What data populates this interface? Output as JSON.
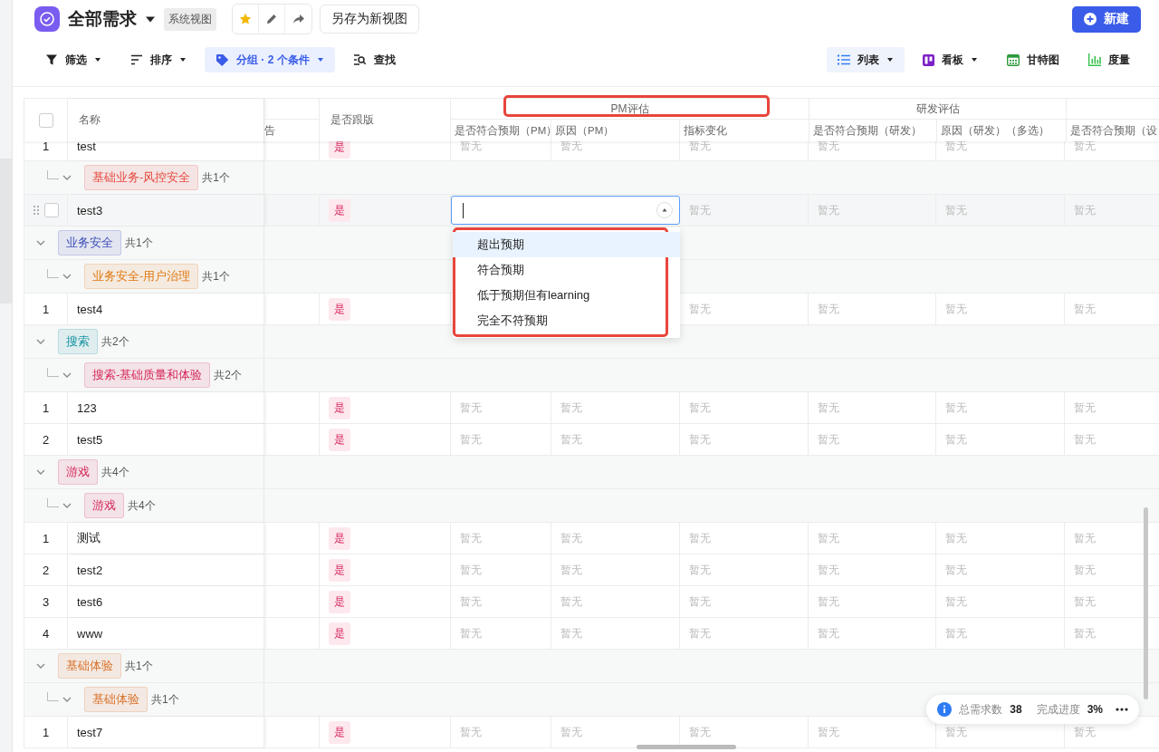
{
  "header": {
    "title": "全部需求",
    "view_badge": "系统视图",
    "favorite": true,
    "save_as_button": "另存为新视图",
    "new_button": "新建"
  },
  "toolbar": {
    "tools": [
      {
        "kind": "filter",
        "label": "筛选",
        "dropdown": true,
        "active": false
      },
      {
        "kind": "sort",
        "label": "排序",
        "dropdown": true,
        "active": false
      },
      {
        "kind": "group",
        "label": "分组 · 2 个条件",
        "dropdown": true,
        "active": true
      },
      {
        "kind": "find",
        "label": "查找",
        "dropdown": false,
        "active": false
      }
    ],
    "views": [
      {
        "kind": "list",
        "label": "列表",
        "dropdown": true,
        "selected": true
      },
      {
        "kind": "board",
        "label": "看板",
        "dropdown": true,
        "selected": false
      },
      {
        "kind": "gantt",
        "label": "甘特图",
        "dropdown": false,
        "selected": false
      },
      {
        "kind": "metrics",
        "label": "度量",
        "dropdown": false,
        "selected": false
      }
    ]
  },
  "table": {
    "select_all": {
      "checked": false
    },
    "columns": [
      {
        "label": "名称"
      },
      {
        "label": "告"
      },
      {
        "label": "是否跟版"
      }
    ],
    "column_groups": [
      {
        "label": "PM评估",
        "outlined": true,
        "columns": [
          "是否符合预期（PM）",
          "原因（PM）",
          "指标变化"
        ]
      },
      {
        "label": "研发评估",
        "columns": [
          "是否符合预期（研发）",
          "原因（研发）（多选）"
        ]
      },
      {
        "columns": [
          "是否符合预期（设"
        ]
      }
    ],
    "body": [
      {
        "kind": "row",
        "index": "1",
        "name": "test",
        "follow": "是",
        "hovered": false,
        "pm_expected": "暂无",
        "pm_reason": "暂无",
        "metric_change": "暂无",
        "dev_expected": "暂无",
        "dev_reason": "暂无",
        "design_expected": "暂无"
      },
      {
        "kind": "subgroup",
        "tag": "基础业务-风控安全",
        "color": "#e5483f",
        "count": "共1个",
        "expanded": true,
        "rows": [
          {
            "kind": "row",
            "name": "test3",
            "follow": "是",
            "hovered": true,
            "checked": false,
            "editor": {
              "outlined": true,
              "options": [
                {
                  "label": "超出预期",
                  "selected": true
                },
                {
                  "label": "符合预期",
                  "selected": false
                },
                {
                  "label": "低于预期但有learning",
                  "selected": false
                },
                {
                  "label": "完全不符预期",
                  "selected": false
                }
              ]
            },
            "metric_change": "暂无",
            "dev_expected": "暂无",
            "dev_reason": "暂无",
            "design_expected": "暂无"
          }
        ]
      },
      {
        "kind": "group",
        "tag": "业务安全",
        "color": "#3d4db7",
        "count": "共1个",
        "expanded": true,
        "children": [
          {
            "kind": "subgroup",
            "tag": "业务安全-用户治理",
            "color": "#e0780f",
            "count": "共1个",
            "expanded": true,
            "rows": [
              {
                "kind": "row",
                "index": "1",
                "name": "test4",
                "follow": "是",
                "hovered": false,
                "metric_change": "暂无",
                "dev_expected": "暂无",
                "dev_reason": "暂无",
                "design_expected": "暂无"
              }
            ]
          }
        ]
      },
      {
        "kind": "group",
        "tag": "搜索",
        "color": "#1592a3",
        "count": "共2个",
        "expanded": true,
        "children": [
          {
            "kind": "subgroup",
            "tag": "搜索-基础质量和体验",
            "color": "#d6285a",
            "count": "共2个",
            "expanded": true,
            "rows": [
              {
                "kind": "row",
                "index": "1",
                "name": "123",
                "follow": "是",
                "hovered": false,
                "pm_expected": "暂无",
                "pm_reason": "暂无",
                "metric_change": "暂无",
                "dev_expected": "暂无",
                "dev_reason": "暂无",
                "design_expected": "暂无"
              },
              {
                "kind": "row",
                "index": "2",
                "name": "test5",
                "follow": "是",
                "hovered": false,
                "pm_expected": "暂无",
                "pm_reason": "暂无",
                "metric_change": "暂无",
                "dev_expected": "暂无",
                "dev_reason": "暂无",
                "design_expected": "暂无"
              }
            ]
          }
        ]
      },
      {
        "kind": "group",
        "tag": "游戏",
        "color": "#d6285a",
        "count": "共4个",
        "expanded": true,
        "children": [
          {
            "kind": "subgroup",
            "tag": "游戏",
            "color": "#d6285a",
            "count": "共4个",
            "expanded": true,
            "rows": [
              {
                "kind": "row",
                "index": "1",
                "name": "测试",
                "follow": "是",
                "hovered": false,
                "pm_expected": "暂无",
                "pm_reason": "暂无",
                "metric_change": "暂无",
                "dev_expected": "暂无",
                "dev_reason": "暂无",
                "design_expected": "暂无"
              },
              {
                "kind": "row",
                "index": "2",
                "name": "test2",
                "follow": "是",
                "hovered": false,
                "pm_expected": "暂无",
                "pm_reason": "暂无",
                "metric_change": "暂无",
                "dev_expected": "暂无",
                "dev_reason": "暂无",
                "design_expected": "暂无"
              },
              {
                "kind": "row",
                "index": "3",
                "name": "test6",
                "follow": "是",
                "hovered": false,
                "pm_expected": "暂无",
                "pm_reason": "暂无",
                "metric_change": "暂无",
                "dev_expected": "暂无",
                "dev_reason": "暂无",
                "design_expected": "暂无"
              },
              {
                "kind": "row",
                "index": "4",
                "name": "www",
                "follow": "是",
                "hovered": false,
                "pm_expected": "暂无",
                "pm_reason": "暂无",
                "metric_change": "暂无",
                "dev_expected": "暂无",
                "dev_reason": "暂无",
                "design_expected": "暂无"
              }
            ]
          }
        ]
      },
      {
        "kind": "group",
        "tag": "基础体验",
        "color": "#d8702a",
        "count": "共1个",
        "expanded": true,
        "children": [
          {
            "kind": "subgroup",
            "tag": "基础体验",
            "color": "#d8702a",
            "count": "共1个",
            "expanded": true,
            "rows": [
              {
                "kind": "row",
                "index": "1",
                "name": "test7",
                "follow": "是",
                "hovered": false,
                "pm_expected": "暂无",
                "pm_reason": "暂无",
                "metric_change": "暂无",
                "dev_expected": "暂无",
                "dev_reason": "暂无",
                "design_expected": "暂无"
              }
            ]
          }
        ]
      }
    ]
  },
  "summary": {
    "total_label": "总需求数",
    "total": "38",
    "progress_label": "完成进度",
    "progress": "3%"
  }
}
